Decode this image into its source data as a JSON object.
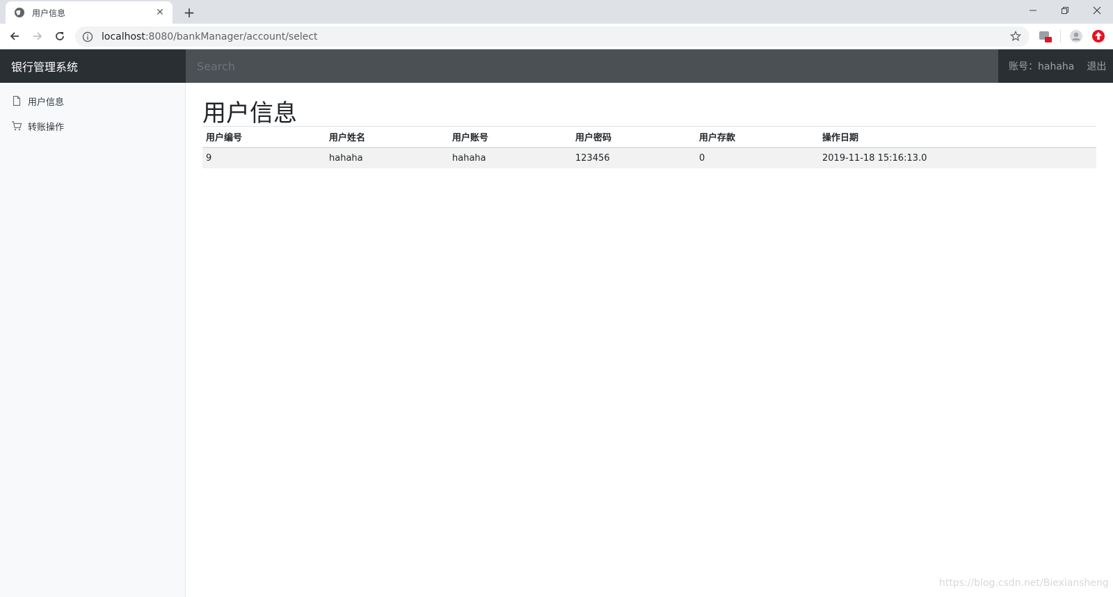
{
  "browser": {
    "tab_title": "用户信息",
    "url_host": "localhost",
    "url_rest": ":8080/bankManager/account/select"
  },
  "icons": {
    "favicon": "globe-icon",
    "close": "close-icon",
    "new_tab": "plus-icon",
    "back": "arrow-left-icon",
    "forward": "arrow-right-icon",
    "reload": "reload-icon",
    "info": "info-icon",
    "star": "star-icon",
    "sidebar_1": "file-icon",
    "sidebar_2": "cart-icon"
  },
  "navbar": {
    "brand": "银行管理系统",
    "search_placeholder": "Search",
    "account_label": "账号：hahaha",
    "logout_label": "退出"
  },
  "sidebar": {
    "items": [
      {
        "label": "用户信息"
      },
      {
        "label": "转账操作"
      }
    ]
  },
  "main": {
    "title": "用户信息",
    "table": {
      "headers": [
        "用户编号",
        "用户姓名",
        "用户账号",
        "用户密码",
        "用户存款",
        "操作日期"
      ],
      "rows": [
        [
          "9",
          "hahaha",
          "hahaha",
          "123456",
          "0",
          "2019-11-18 15:16:13.0"
        ]
      ]
    }
  },
  "watermark": "https://blog.csdn.net/Biexiansheng",
  "colors": {
    "navbar": "#343a40",
    "search_bg": "#4b5055",
    "sidebar_bg": "#f8f9fa",
    "row_bg": "#f2f2f2"
  }
}
